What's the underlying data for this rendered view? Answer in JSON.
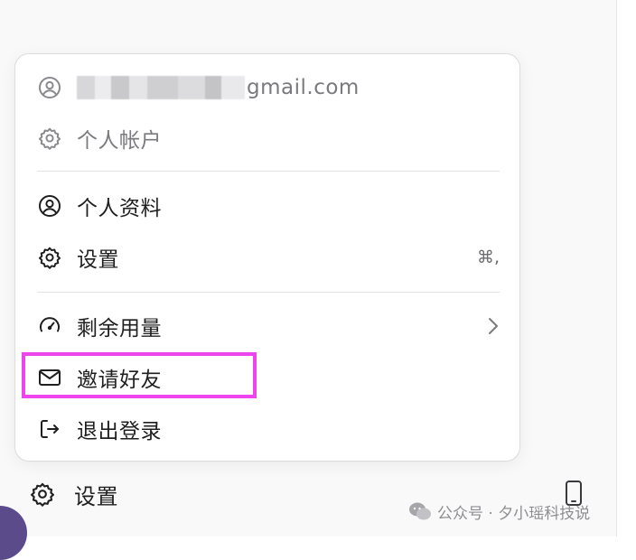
{
  "account": {
    "email_suffix": "gmail.com",
    "personal_account_label": "个人帐户"
  },
  "menu": {
    "items": [
      {
        "label": "个人资料",
        "icon": "user-circle-icon"
      },
      {
        "label": "设置",
        "icon": "gear-icon",
        "shortcut": "⌘,"
      },
      {
        "label": "剩余用量",
        "icon": "speedometer-icon",
        "trail_icon": "chevron-right-icon"
      },
      {
        "label": "邀请好友",
        "icon": "envelope-icon"
      },
      {
        "label": "退出登录",
        "icon": "logout-icon"
      }
    ]
  },
  "sidebar_footer": {
    "settings_label": "设置",
    "device_icon": "phone-icon"
  },
  "watermark": {
    "text": "公众号 · 夕小瑶科技说"
  },
  "colors": {
    "highlight": "#ee44ee",
    "muted_text": "#7a7a7e",
    "divider": "#e3e3e6"
  }
}
